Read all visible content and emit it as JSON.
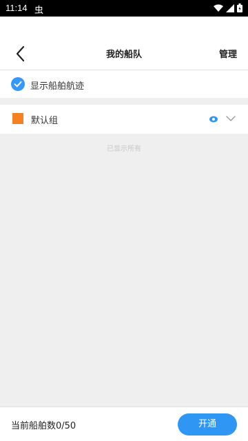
{
  "status_bar": {
    "time": "11:14",
    "notification": "虫"
  },
  "header": {
    "title": "我的船队",
    "manage_label": "管理",
    "back_icon": "back-arrow-icon"
  },
  "show_track": {
    "label": "显示船舶航迹",
    "checked": true
  },
  "group": {
    "label": "默认组",
    "color": "#f58220"
  },
  "list_status": "已显示所有",
  "footer": {
    "count_text": "当前船舶数0/50",
    "open_label": "开通"
  },
  "colors": {
    "accent": "#2f96f3",
    "background": "#efefef"
  }
}
